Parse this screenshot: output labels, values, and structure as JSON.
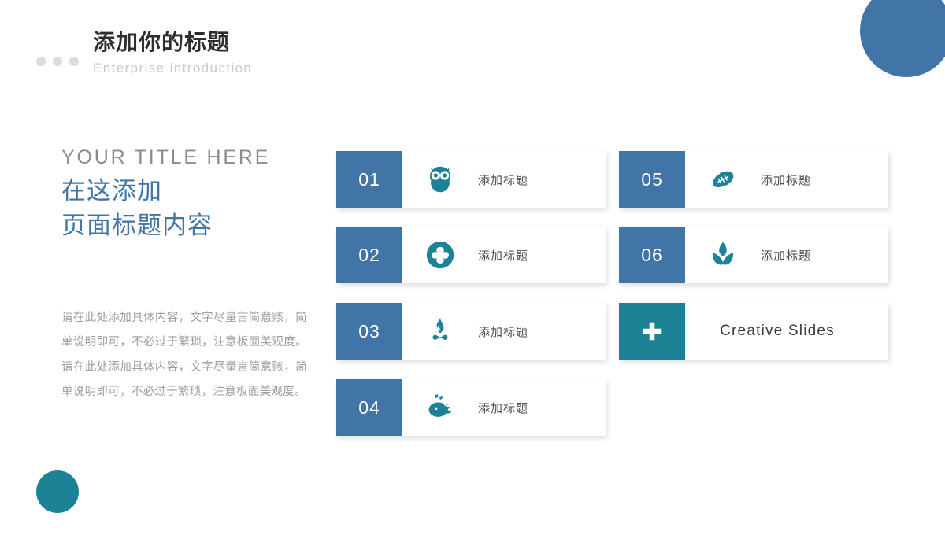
{
  "slide": {
    "background": "#ffffff",
    "accent_blue": "#4175A8",
    "accent_teal": "#1E8296"
  },
  "header": {
    "title": "添加你的标题",
    "subtitle": "Enterprise  introduction",
    "dots_color": "#DCDCDC"
  },
  "left": {
    "eyebrow": "YOUR  TITLE  HERE",
    "headline_line1": "在这添加",
    "headline_line2": "页面标题内容",
    "body": "请在此处添加具体内容，文字尽量言简意赅，简单说明即可，不必过于繁琐，注意板面美观度。请在此处添加具体内容，文字尽量言简意赅，简单说明即可，不必过于繁琐，注意板面美观度。"
  },
  "cards": [
    {
      "number": "01",
      "label": "添加标题",
      "icon": "owl-icon",
      "num_color": "#4175A8",
      "icon_color": "#1E8296"
    },
    {
      "number": "02",
      "label": "添加标题",
      "icon": "clover-icon",
      "num_color": "#4175A8",
      "icon_color": "#1E8296"
    },
    {
      "number": "03",
      "label": "添加标题",
      "icon": "campfire-icon",
      "num_color": "#4175A8",
      "icon_color": "#1E8296"
    },
    {
      "number": "04",
      "label": "添加标题",
      "icon": "whale-icon",
      "num_color": "#4175A8",
      "icon_color": "#1E8296"
    },
    {
      "number": "05",
      "label": "添加标题",
      "icon": "football-icon",
      "num_color": "#4175A8",
      "icon_color": "#1E8296"
    },
    {
      "number": "06",
      "label": "添加标题",
      "icon": "sprout-icon",
      "num_color": "#4175A8",
      "icon_color": "#1E8296"
    },
    {
      "number": "",
      "label": "Creative  Slides",
      "icon": "plus-cross-icon",
      "num_color": "#1E8296",
      "icon_color": "#FFFFFF"
    }
  ],
  "decorations": {
    "top_right_circle_color": "#4175A8",
    "bottom_left_circle_color": "#1E8296"
  }
}
